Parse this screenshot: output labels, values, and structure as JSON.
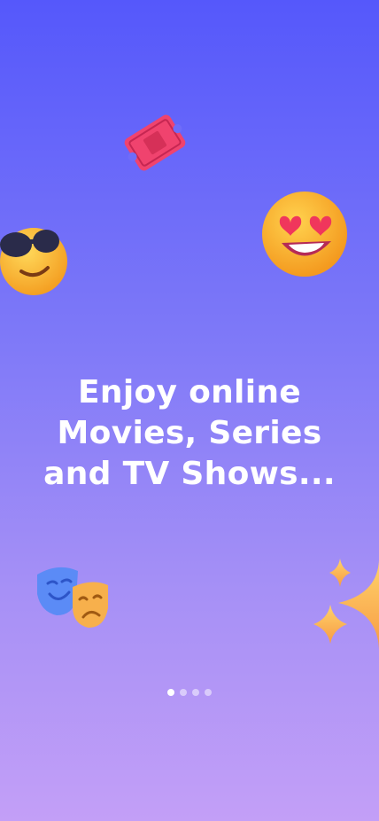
{
  "onboarding": {
    "headline_lines": [
      "Enjoy online",
      "Movies, Series",
      "and TV Shows..."
    ]
  },
  "pagination": {
    "total": 4,
    "active_index": 0
  },
  "decorations": [
    "ticket-icon",
    "sunglasses-emoji",
    "heart-eyes-emoji",
    "theater-masks-icon",
    "sparkles-icon"
  ],
  "colors": {
    "gradient_top": "#5558fb",
    "gradient_bottom": "#c39ff7",
    "text": "#ffffff"
  }
}
